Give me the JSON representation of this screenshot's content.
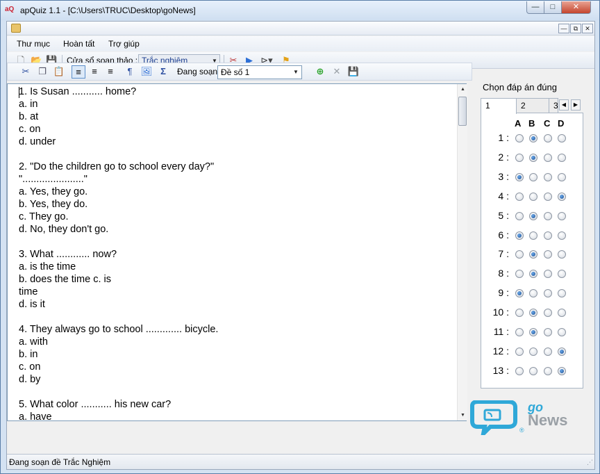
{
  "window": {
    "title": "apQuiz 1.1 - [C:\\Users\\TRUC\\Desktop\\goNews]",
    "app_icon_text": "aQ",
    "minimize": "—",
    "maximize": "□",
    "close": "✕"
  },
  "mdi": {
    "minimize": "—",
    "restore": "⧉",
    "close": "✕"
  },
  "menu": {
    "items": [
      "Thư mục",
      "Hoàn tất",
      "Trợ giúp"
    ]
  },
  "toolbar": {
    "editor_window_label": "Cửa sổ soạn thảo :",
    "editor_type_value": "Trắc nghiệm"
  },
  "editor_toolbar": {
    "editing_label": "Đang soạn :",
    "exam_value": "Đề số 1"
  },
  "editor": {
    "text": "1. Is Susan ........... home?\na. in\nb. at\nc. on\nd. under\n\n2. \"Do the children go to school every day?\"\n\"......................\"\na. Yes, they go.\nb. Yes, they do.\nc. They go.\nd. No, they don't go.\n\n3. What ............ now?\na. is the time\nb. does the time c. is\ntime\nd. is it\n\n4. They always go to school ............. bicycle.\na. with\nb. in\nc. on\nd. by\n\n5. What color ........... his new car?\na. have"
  },
  "answers": {
    "title": "Chọn đáp án đúng",
    "tabs": [
      "1",
      "2",
      "3"
    ],
    "columns": [
      "A",
      "B",
      "C",
      "D"
    ],
    "rows": [
      {
        "label": "1 :",
        "selected": "B"
      },
      {
        "label": "2 :",
        "selected": "B"
      },
      {
        "label": "3 :",
        "selected": "A"
      },
      {
        "label": "4 :",
        "selected": "D"
      },
      {
        "label": "5 :",
        "selected": "B"
      },
      {
        "label": "6 :",
        "selected": "A"
      },
      {
        "label": "7 :",
        "selected": "B"
      },
      {
        "label": "8 :",
        "selected": "B"
      },
      {
        "label": "9 :",
        "selected": "A"
      },
      {
        "label": "10 :",
        "selected": "B"
      },
      {
        "label": "11 :",
        "selected": "B"
      },
      {
        "label": "12 :",
        "selected": "D"
      },
      {
        "label": "13 :",
        "selected": "D"
      }
    ]
  },
  "logo": {
    "go": "go",
    "news": "News",
    "registered": "®"
  },
  "status": {
    "text": "Đang soạn đề Trắc Nghiệm"
  },
  "colors": {
    "accent": "#1d4f93",
    "logo_blue": "#2fa8d8",
    "combo_text": "#1a3d8f"
  }
}
